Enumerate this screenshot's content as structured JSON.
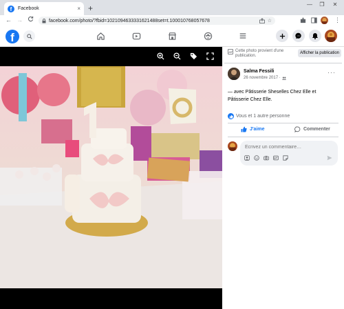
{
  "browser": {
    "tab_title": "Facebook",
    "tab_close": "×",
    "new_tab": "+",
    "window_minimize": "—",
    "window_restore": "❐",
    "window_close": "✕",
    "back": "←",
    "forward": "→",
    "reload": "C",
    "url": "facebook.com/photo/?fbid=1021094633331621488set=t.100010768057678"
  },
  "fb": {
    "logo": "f"
  },
  "panel": {
    "notice_text": "Cette photo provient d'une publication.",
    "notice_button": "Afficher la publication",
    "author": "Salma Fessili",
    "date": "26 novembre 2017 ·",
    "more": "···",
    "post_text": "— avec Pâtisserie Sheselles Chez Elle et Pâtisserie Chez Elle.",
    "reactions": "Vous et 1 autre personne",
    "like_label": "J'aime",
    "comment_label": "Commenter",
    "comment_placeholder": "Écrivez un commentaire…"
  },
  "colors": {
    "brand": "#1877f2",
    "muted": "#65676b"
  }
}
